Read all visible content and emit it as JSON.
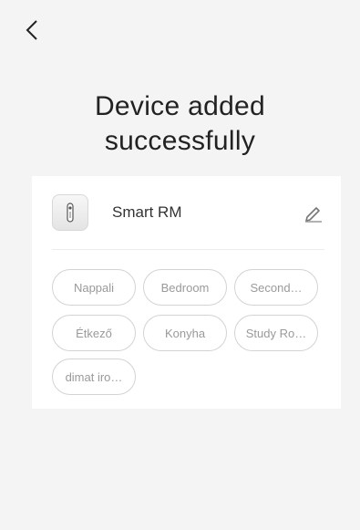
{
  "header": {
    "back_icon": "chevron-left-icon"
  },
  "title": {
    "line1": "Device added",
    "line2": "successfully"
  },
  "device": {
    "name": "Smart RM",
    "icon": "remote-control-icon",
    "edit_icon": "pencil-icon"
  },
  "rooms": [
    "Nappali",
    "Bedroom",
    "Second…",
    "Étkező",
    "Konyha",
    "Study Ro…",
    "dimat iro…"
  ]
}
